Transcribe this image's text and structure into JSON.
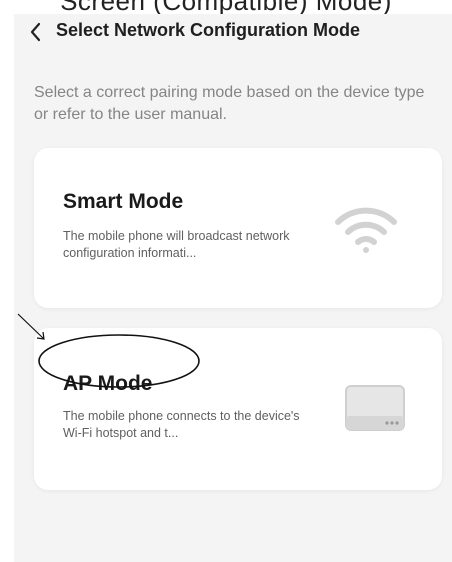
{
  "caption_fragment": "Screen (Compatible) Mode)",
  "nav": {
    "title": "Select Network Configuration Mode",
    "back_icon": "chevron-left-icon"
  },
  "intro_text": "Select a correct pairing mode based on the device type or refer to the user manual.",
  "modes": [
    {
      "title": "Smart Mode",
      "description": "The mobile phone will broadcast network configuration informati...",
      "icon": "wifi-icon"
    },
    {
      "title": "AP Mode",
      "description": "The mobile phone connects to the device's Wi-Fi hotspot and t...",
      "icon": "device-hotspot-icon"
    }
  ],
  "annotation": {
    "highlighted_item": "AP Mode",
    "marks": [
      "arrow-annotation",
      "circle-annotation"
    ]
  }
}
